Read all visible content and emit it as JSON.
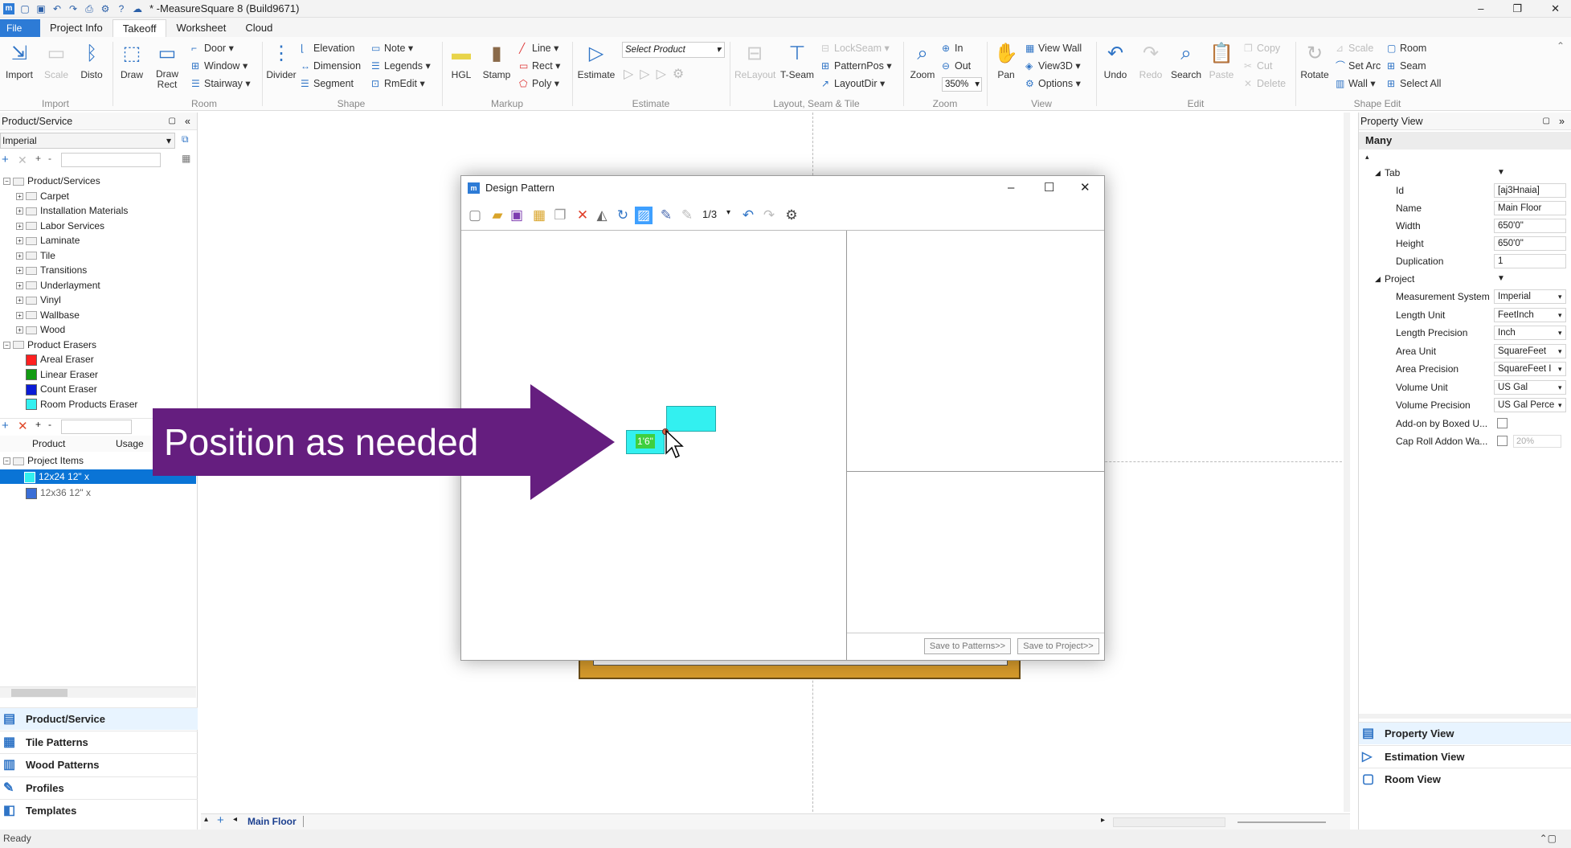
{
  "window": {
    "title": "* -MeasureSquare 8 (Build9671)",
    "minimize": "–",
    "maximize": "❐",
    "close": "✕"
  },
  "menu_tabs": {
    "file": "File",
    "project_info": "Project Info",
    "takeoff": "Takeoff",
    "worksheet": "Worksheet",
    "cloud": "Cloud"
  },
  "ribbon": {
    "import": {
      "import": "Import",
      "scale": "Scale",
      "disto": "Disto",
      "group": "Import"
    },
    "room": {
      "draw": "Draw",
      "draw_rect": "Draw Rect",
      "door": "Door",
      "window": "Window",
      "stairway": "Stairway",
      "group": "Room"
    },
    "shape": {
      "divider": "Divider",
      "elevation": "Elevation",
      "dimension": "Dimension",
      "segment": "Segment",
      "note": "Note",
      "legends": "Legends",
      "rmedit": "RmEdit",
      "group": "Shape"
    },
    "markup": {
      "hgl": "HGL",
      "stamp": "Stamp",
      "line": "Line",
      "rect": "Rect",
      "poly": "Poly",
      "group": "Markup"
    },
    "estimate": {
      "estimate": "Estimate",
      "select_product": "Select Product",
      "group": "Estimate"
    },
    "layout": {
      "relayout": "ReLayout",
      "tseam": "T-Seam",
      "lockseam": "LockSeam",
      "patternpos": "PatternPos",
      "layoutdir": "LayoutDir",
      "group": "Layout, Seam & Tile"
    },
    "zoom": {
      "zoom": "Zoom",
      "in": "In",
      "out": "Out",
      "level": "350%",
      "group": "Zoom"
    },
    "view": {
      "pan": "Pan",
      "view_wall": "View Wall",
      "view3d": "View3D",
      "options": "Options",
      "group": "View"
    },
    "edit": {
      "undo": "Undo",
      "redo": "Redo",
      "search": "Search",
      "paste": "Paste",
      "copy": "Copy",
      "cut": "Cut",
      "delete": "Delete",
      "group": "Edit"
    },
    "shape_edit": {
      "rotate": "Rotate",
      "scale": "Scale",
      "set_arc": "Set Arc",
      "wall": "Wall",
      "room": "Room",
      "seam": "Seam",
      "select_all": "Select All",
      "group": "Shape Edit"
    }
  },
  "left": {
    "panel_title": "Product/Service",
    "unit_select": "Imperial",
    "tree": [
      "Product/Services",
      "Carpet",
      "Installation Materials",
      "Labor Services",
      "Laminate",
      "Tile",
      "Transitions",
      "Underlayment",
      "Vinyl",
      "Wallbase",
      "Wood",
      "Product Erasers",
      "Areal Eraser",
      "Linear Eraser",
      "Count Eraser",
      "Room Products Eraser"
    ],
    "col_product": "Product",
    "col_usage": "Usage",
    "project_items": "Project Items",
    "item1": "12x24 12\" x",
    "item2": "12x36 12\" x",
    "nav": [
      "Product/Service",
      "Tile Patterns",
      "Wood Patterns",
      "Profiles",
      "Templates"
    ]
  },
  "dialog": {
    "title": "Design Pattern",
    "page": "1/3",
    "dim_label": "1'6\"",
    "save_patterns": "Save to Patterns>>",
    "save_project": "Save to Project>>"
  },
  "callout": {
    "text": "Position as needed"
  },
  "right": {
    "panel_title": "Property View",
    "header": "Many",
    "tab_section": "Tab",
    "project_section": "Project",
    "props": [
      {
        "label": "Id",
        "value": "[aj3Hnaia]"
      },
      {
        "label": "Name",
        "value": "Main Floor"
      },
      {
        "label": "Width",
        "value": "650'0\""
      },
      {
        "label": "Height",
        "value": "650'0\""
      },
      {
        "label": "Duplication",
        "value": "1"
      }
    ],
    "project_props": [
      {
        "label": "Measurement System",
        "value": "Imperial"
      },
      {
        "label": "Length Unit",
        "value": "FeetInch"
      },
      {
        "label": "Length Precision",
        "value": "Inch"
      },
      {
        "label": "Area Unit",
        "value": "SquareFeet"
      },
      {
        "label": "Area Precision",
        "value": "SquareFeet I"
      },
      {
        "label": "Volume Unit",
        "value": "US Gal"
      },
      {
        "label": "Volume Precision",
        "value": "US Gal Perce"
      },
      {
        "label": "Add-on by Boxed U...",
        "value": ""
      },
      {
        "label": "Cap Roll Addon Wa...",
        "value": "20%"
      }
    ],
    "nav": [
      "Property View",
      "Estimation View",
      "Room View"
    ]
  },
  "bottom": {
    "floor_tab": "Main Floor"
  },
  "status": {
    "text": "Ready"
  }
}
